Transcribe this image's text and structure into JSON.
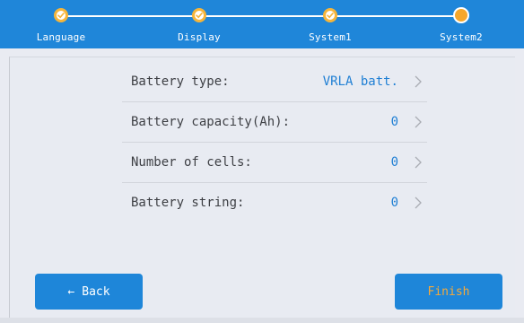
{
  "colors": {
    "header_bg": "#1f86d9",
    "accent_blue": "#1f7fd4",
    "done_ring": "#f5b53a",
    "current_dot": "#f7a72a",
    "finish_text": "#f5a93a"
  },
  "stepper": {
    "steps": [
      {
        "label": "Language",
        "state": "done"
      },
      {
        "label": "Display",
        "state": "done"
      },
      {
        "label": "System1",
        "state": "done"
      },
      {
        "label": "System2",
        "state": "current"
      }
    ]
  },
  "settings": {
    "rows": [
      {
        "label": "Battery type:",
        "value": "VRLA batt.",
        "icon": "chevron-right-icon"
      },
      {
        "label": "Battery capacity(Ah):",
        "value": "0",
        "icon": "chevron-right-icon"
      },
      {
        "label": "Number of cells:",
        "value": "0",
        "icon": "chevron-right-icon"
      },
      {
        "label": "Battery string:",
        "value": "0",
        "icon": "chevron-right-icon"
      }
    ]
  },
  "buttons": {
    "back_arrow": "←",
    "back_label": "Back",
    "finish_label": "Finish"
  }
}
